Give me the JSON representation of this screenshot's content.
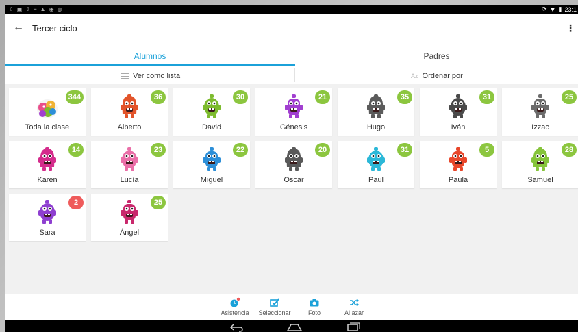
{
  "status": {
    "time": "23:1"
  },
  "header": {
    "title": "Tercer ciclo"
  },
  "tabs": [
    {
      "label": "Alumnos"
    },
    {
      "label": "Padres"
    }
  ],
  "toolbar": {
    "list_label": "Ver como lista",
    "sort_label": "Ordenar por",
    "sort_icon_text": "Az"
  },
  "colors": {
    "accent": "#1ba1d9",
    "badge_green": "#8cc63f",
    "badge_red": "#ef5b5b"
  },
  "students": [
    {
      "name": "Toda la clase",
      "points": "344",
      "badge": "green",
      "color": "multi"
    },
    {
      "name": "Alberto",
      "points": "36",
      "badge": "green",
      "color": "#e2542a"
    },
    {
      "name": "David",
      "points": "30",
      "badge": "green",
      "color": "#7dbb2e"
    },
    {
      "name": "Génesis",
      "points": "21",
      "badge": "green",
      "color": "#a13fd0"
    },
    {
      "name": "Hugo",
      "points": "35",
      "badge": "green",
      "color": "#5b5b5b"
    },
    {
      "name": "Iván",
      "points": "31",
      "badge": "green",
      "color": "#4a4a4a"
    },
    {
      "name": "Izzac",
      "points": "25",
      "badge": "green",
      "color": "#6c6c6c"
    },
    {
      "name": "Karen",
      "points": "14",
      "badge": "green",
      "color": "#d42c8c"
    },
    {
      "name": "Lucía",
      "points": "23",
      "badge": "green",
      "color": "#ea6fa8"
    },
    {
      "name": "Miguel",
      "points": "22",
      "badge": "green",
      "color": "#2d8fd8"
    },
    {
      "name": "Oscar",
      "points": "20",
      "badge": "green",
      "color": "#595959"
    },
    {
      "name": "Paul",
      "points": "31",
      "badge": "green",
      "color": "#2cb8d8"
    },
    {
      "name": "Paula",
      "points": "5",
      "badge": "green",
      "color": "#e8462a"
    },
    {
      "name": "Samuel",
      "points": "28",
      "badge": "green",
      "color": "#86c43b"
    },
    {
      "name": "Sara",
      "points": "2",
      "badge": "red",
      "color": "#8e3fd0"
    },
    {
      "name": "Ángel",
      "points": "25",
      "badge": "green",
      "color": "#c9286c"
    }
  ],
  "actions": [
    {
      "label": "Asistencia",
      "icon": "clock-icon"
    },
    {
      "label": "Seleccionar",
      "icon": "checkbox-icon"
    },
    {
      "label": "Foto",
      "icon": "camera-icon"
    },
    {
      "label": "Al azar",
      "icon": "shuffle-icon"
    }
  ]
}
